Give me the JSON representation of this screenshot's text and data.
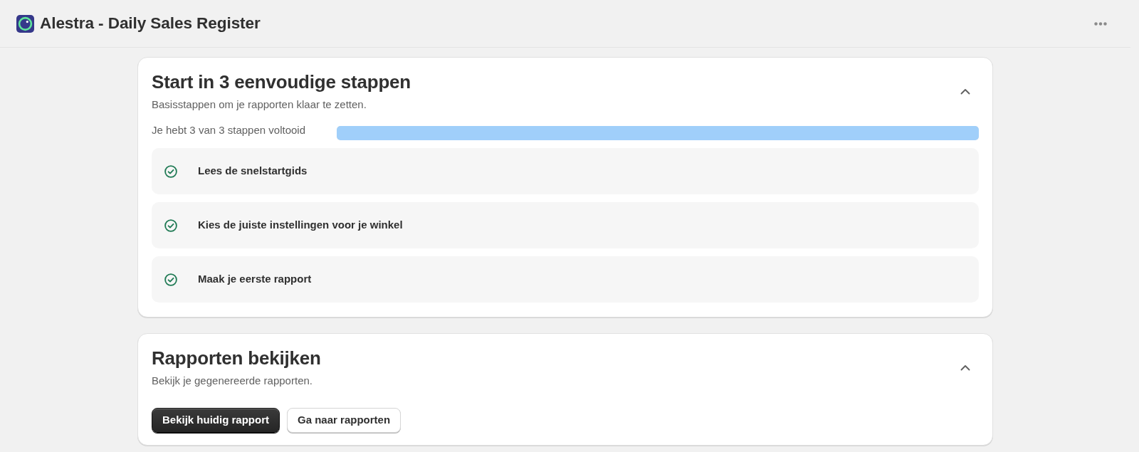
{
  "app": {
    "title": "Alestra - Daily Sales Register"
  },
  "cards": [
    {
      "kind": "checklist",
      "title": "Start in 3 eenvoudige stappen",
      "subtitle": "Basisstappen om je rapporten klaar te zetten.",
      "expanded": true,
      "progress": {
        "text": "Je hebt 3 van 3 stappen voltooid",
        "level": 1
      },
      "steps": [
        {
          "label": "Lees de snelstartgids",
          "completed": true
        },
        {
          "label": "Kies de juiste instellingen voor je winkel",
          "completed": true
        },
        {
          "label": "Maak je eerste rapport",
          "completed": true
        }
      ]
    },
    {
      "kind": "actions",
      "title": "Rapporten bekijken",
      "subtitle": "Bekijk je gegenereerde rapporten.",
      "expanded": true,
      "buttons": [
        {
          "label": "Bekijk huidig rapport",
          "kind": "primary"
        },
        {
          "label": "Ga naar rapporten",
          "kind": "secondary"
        }
      ]
    }
  ]
}
